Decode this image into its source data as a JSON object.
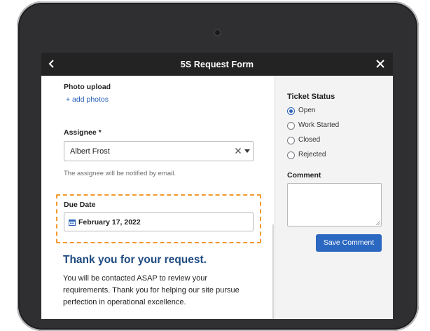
{
  "header": {
    "title": "5S Request Form"
  },
  "form": {
    "photo_label": "Photo upload",
    "add_photos": "+ add photos",
    "assignee_label": "Assignee *",
    "assignee_value": "Albert Frost",
    "assignee_help": "The assignee will be notified by email.",
    "due_label": "Due Date",
    "due_value": "February 17, 2022",
    "thanks_heading": "Thank you for your request.",
    "thanks_lines": [
      "You will be contacted ASAP to review your",
      "requirements.  Thank you for helping our site pursue",
      "perfection in operational excellence."
    ]
  },
  "sidebar": {
    "status_heading": "Ticket Status",
    "statuses": [
      {
        "label": "Open",
        "checked": true
      },
      {
        "label": "Work Started",
        "checked": false
      },
      {
        "label": "Closed",
        "checked": false
      },
      {
        "label": "Rejected",
        "checked": false
      }
    ],
    "comment_label": "Comment",
    "comment_value": "",
    "save_label": "Save Comment"
  },
  "colors": {
    "accent": "#2b68c1",
    "heading": "#1f4a80",
    "highlight": "#f29a2e",
    "topbar": "#232324"
  },
  "icons": [
    "back-icon",
    "close-icon",
    "clear-icon",
    "chevron-down-icon",
    "calendar-icon",
    "camera-icon"
  ]
}
